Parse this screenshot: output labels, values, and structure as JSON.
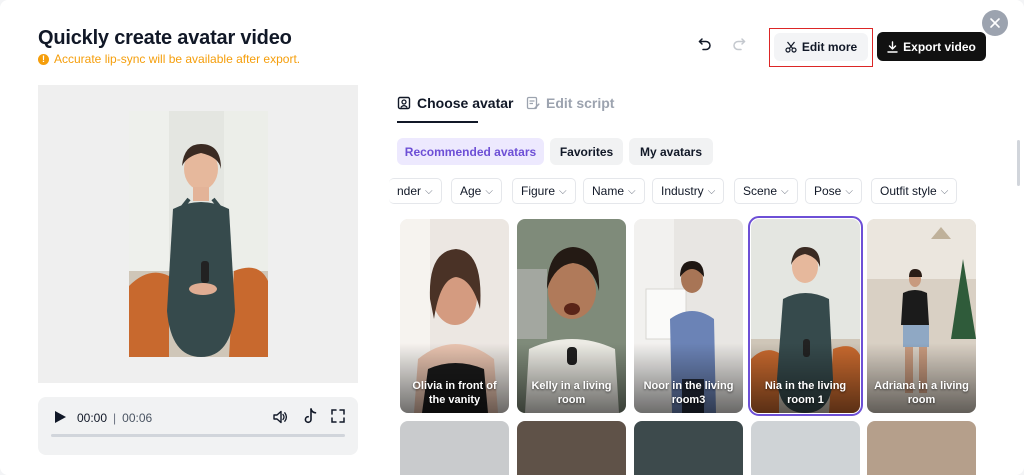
{
  "header": {
    "title": "Quickly create avatar video",
    "notice": "Accurate lip-sync will be available after export.",
    "edit_more": "Edit more",
    "export": "Export video"
  },
  "player": {
    "current_time": "00:00",
    "separator": "|",
    "duration": "00:06"
  },
  "tabs": [
    {
      "label": "Choose avatar",
      "active": true
    },
    {
      "label": "Edit script",
      "active": false
    }
  ],
  "categories": [
    {
      "label": "Recommended avatars",
      "active": true
    },
    {
      "label": "Favorites",
      "active": false
    },
    {
      "label": "My avatars",
      "active": false
    }
  ],
  "filters": [
    "nder",
    "Age",
    "Figure",
    "Name",
    "Industry",
    "Scene",
    "Pose",
    "Outfit style"
  ],
  "avatars": [
    {
      "name": "Olivia in front of the vanity",
      "selected": false
    },
    {
      "name": "Kelly in a living room",
      "selected": false
    },
    {
      "name": "Noor in the living room3",
      "selected": false
    },
    {
      "name": "Nia in the living room 1",
      "selected": true
    },
    {
      "name": "Adriana in a living room",
      "selected": false
    }
  ],
  "colors": {
    "accent": "#6d4fd6",
    "accent_bg": "#ede9fe",
    "warning": "#f59e0b",
    "primary_button": "#111111",
    "highlight": "#dc2626"
  }
}
